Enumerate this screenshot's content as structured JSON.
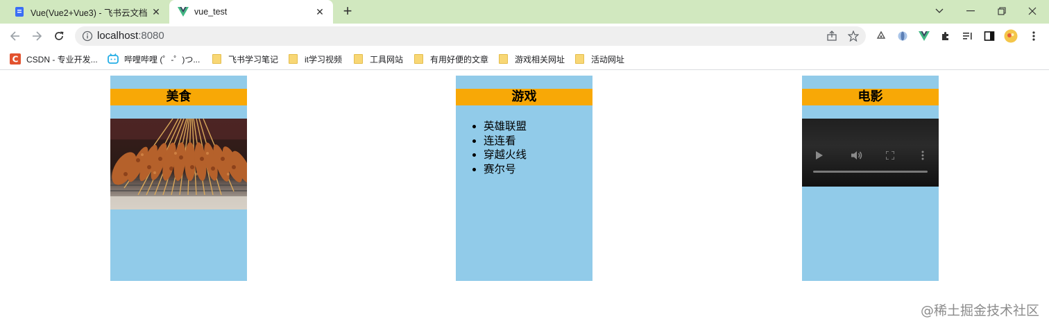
{
  "browser": {
    "tabs": [
      {
        "title": "Vue(Vue2+Vue3) - 飞书云文档",
        "icon": "feishu-doc-icon",
        "active": false
      },
      {
        "title": "vue_test",
        "icon": "vue-logo-icon",
        "active": true
      }
    ],
    "address": {
      "host": "localhost",
      "port": ":8080"
    },
    "bookmarks": [
      {
        "label": "CSDN - 专业开发...",
        "icon": "csdn-icon"
      },
      {
        "label": "哔哩哔哩 (゜-゜)つ...",
        "icon": "bilibili-icon"
      },
      {
        "label": "飞书学习笔记",
        "icon": "folder-icon"
      },
      {
        "label": "it学习视频",
        "icon": "folder-icon"
      },
      {
        "label": "工具网站",
        "icon": "folder-icon"
      },
      {
        "label": "有用好便的文章",
        "icon": "folder-icon"
      },
      {
        "label": "游戏相关网址",
        "icon": "folder-icon"
      },
      {
        "label": "活动网址",
        "icon": "folder-icon"
      }
    ]
  },
  "categories": [
    {
      "title": "美食",
      "content": "image"
    },
    {
      "title": "游戏",
      "content": "list",
      "items": [
        "英雄联盟",
        "连连看",
        "穿越火线",
        "赛尔号"
      ]
    },
    {
      "title": "电影",
      "content": "video"
    }
  ],
  "colors": {
    "card_bg": "#91cbe9",
    "card_title_bg": "#f8a806",
    "tabstrip_bg": "#d1e8bf"
  },
  "watermark": "@稀土掘金技术社区"
}
